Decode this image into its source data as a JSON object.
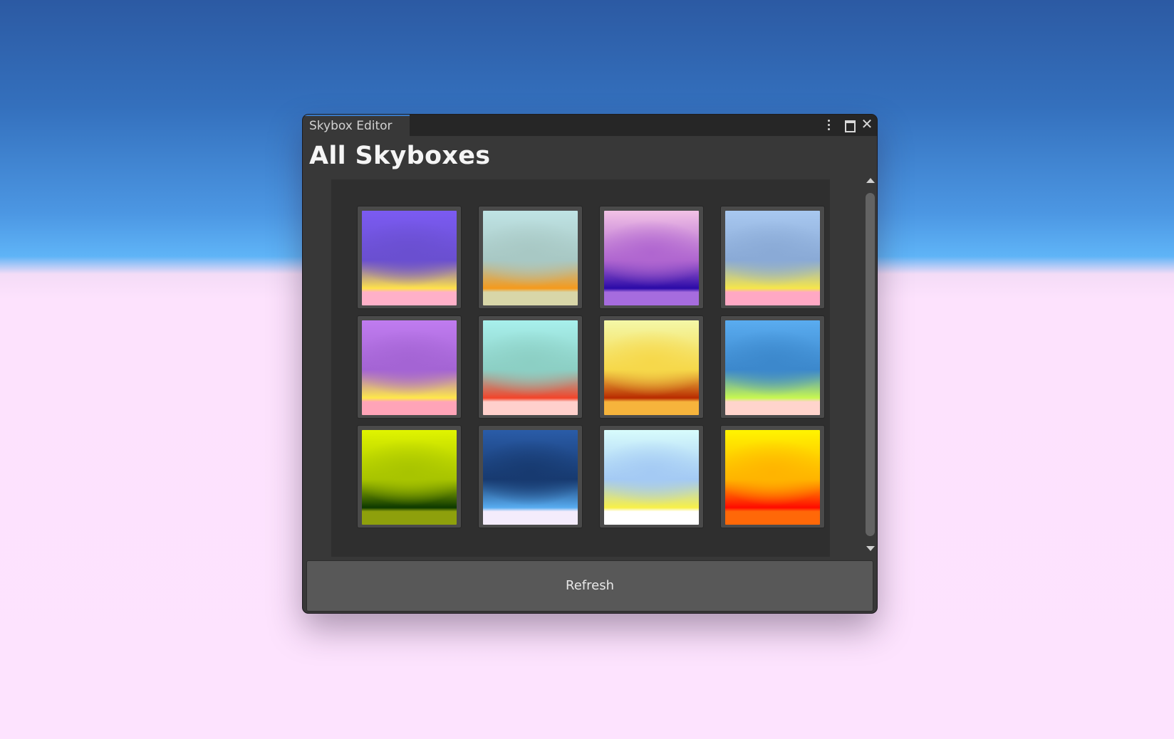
{
  "window": {
    "tab_label": "Skybox Editor",
    "title": "All Skyboxes",
    "controls": [
      "more-options-icon",
      "maximize-icon",
      "close-icon"
    ],
    "close_glyph": "✕"
  },
  "skyboxes": [
    {
      "top": "#7b5bf2",
      "mid": "#6a4fd0",
      "horizon": "#ffe24a",
      "ground": "#ffb0c8"
    },
    {
      "top": "#bfe3e4",
      "mid": "#a8c8c4",
      "horizon": "#f59a1c",
      "ground": "#d8d6a8"
    },
    {
      "top": "#f2c2e6",
      "mid": "#b066d0",
      "horizon": "#2a0aa8",
      "ground": "#a66cde"
    },
    {
      "top": "#a8c8f0",
      "mid": "#8aaad6",
      "horizon": "#f6e64a",
      "ground": "#ffa8c4"
    },
    {
      "top": "#c07cf0",
      "mid": "#a464d4",
      "horizon": "#ffe84a",
      "ground": "#ffa4b8"
    },
    {
      "top": "#a8f0ec",
      "mid": "#8ccfc4",
      "horizon": "#f2442a",
      "ground": "#ffd0cc"
    },
    {
      "top": "#f4f8a8",
      "mid": "#f6d84a",
      "horizon": "#b82a00",
      "ground": "#f6b43c"
    },
    {
      "top": "#5aacf0",
      "mid": "#3c88cc",
      "horizon": "#c8f850",
      "ground": "#ffd4cc"
    },
    {
      "top": "#e0f400",
      "mid": "#a8c400",
      "horizon": "#0c3800",
      "ground": "#8ea00c"
    },
    {
      "top": "#2a5ca8",
      "mid": "#173a70",
      "horizon": "#58acf0",
      "ground": "#f4ecfc"
    },
    {
      "top": "#d8fcfc",
      "mid": "#a4caf4",
      "horizon": "#f8f048",
      "ground": "#ffffff"
    },
    {
      "top": "#fff400",
      "mid": "#ffb400",
      "horizon": "#ff0a00",
      "ground": "#ff6808"
    }
  ],
  "scrollbar": {
    "position": 0
  },
  "refresh_label": "Refresh"
}
